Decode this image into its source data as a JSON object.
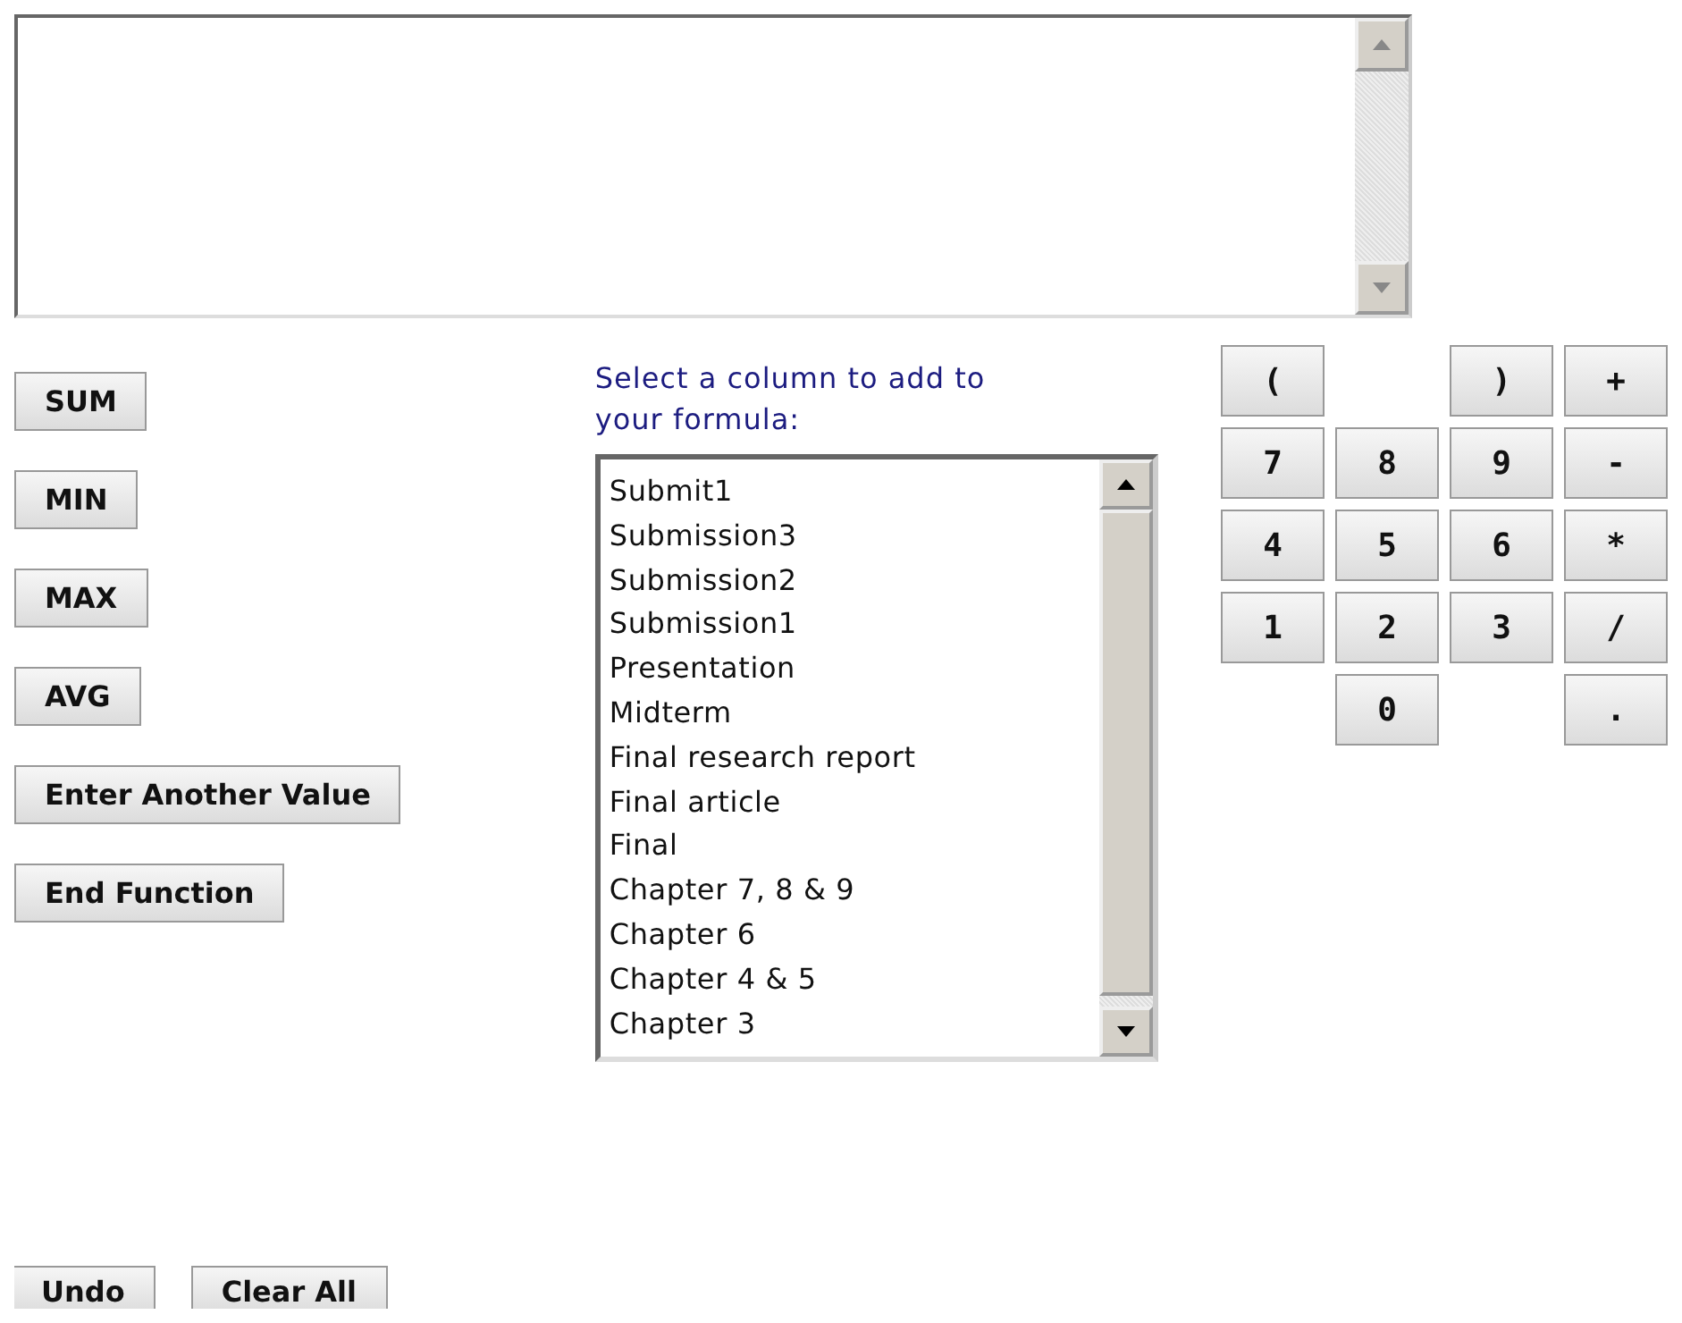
{
  "function_buttons": [
    {
      "label": "SUM"
    },
    {
      "label": "MIN"
    },
    {
      "label": "MAX"
    },
    {
      "label": "AVG"
    },
    {
      "label": "Enter Another Value"
    },
    {
      "label": "End Function"
    }
  ],
  "column_picker": {
    "label": "Select a column to add to your formula:",
    "items": [
      {
        "label": "Submit1",
        "selected": false
      },
      {
        "label": "Submission3",
        "selected": false
      },
      {
        "label": "Submission2",
        "selected": false
      },
      {
        "label": "Submission1",
        "selected": false
      },
      {
        "label": "Presentation",
        "selected": false
      },
      {
        "label": "Midterm",
        "selected": false
      },
      {
        "label": "Final research report",
        "selected": false
      },
      {
        "label": "Final article",
        "selected": false
      },
      {
        "label": "Final",
        "selected": false
      },
      {
        "label": "Chapter 7, 8 & 9",
        "selected": false
      },
      {
        "label": "Chapter 6",
        "selected": false
      },
      {
        "label": "Chapter 4 & 5",
        "selected": false
      },
      {
        "label": "Chapter 3",
        "selected": false
      }
    ]
  },
  "keypad": [
    [
      {
        "kind": "key",
        "label": "("
      },
      {
        "kind": "gap"
      },
      {
        "kind": "key",
        "label": ")"
      },
      {
        "kind": "key",
        "label": "+"
      }
    ],
    [
      {
        "kind": "key",
        "label": "7"
      },
      {
        "kind": "key",
        "label": "8"
      },
      {
        "kind": "key",
        "label": "9"
      },
      {
        "kind": "key",
        "label": "-"
      }
    ],
    [
      {
        "kind": "key",
        "label": "4"
      },
      {
        "kind": "key",
        "label": "5"
      },
      {
        "kind": "key",
        "label": "6"
      },
      {
        "kind": "key",
        "label": "*"
      }
    ],
    [
      {
        "kind": "key",
        "label": "1"
      },
      {
        "kind": "key",
        "label": "2"
      },
      {
        "kind": "key",
        "label": "3"
      },
      {
        "kind": "key",
        "label": "/"
      }
    ],
    [
      {
        "kind": "gap"
      },
      {
        "kind": "key",
        "label": "0"
      },
      {
        "kind": "gap"
      },
      {
        "kind": "key",
        "label": "."
      }
    ]
  ],
  "bottom_buttons": [
    {
      "label": "Undo"
    },
    {
      "label": "Clear All"
    }
  ]
}
